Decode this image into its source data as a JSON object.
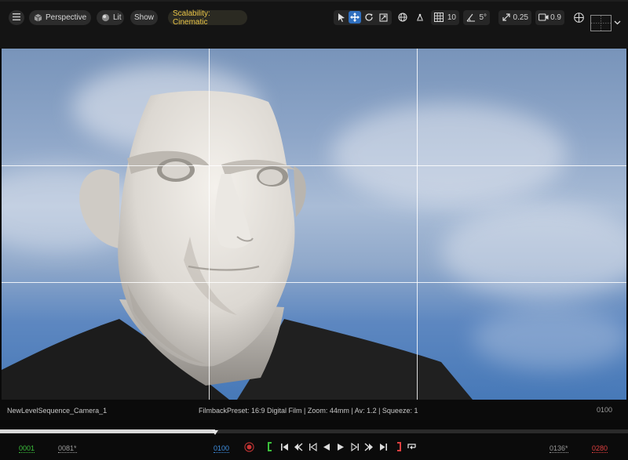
{
  "toolbar": {
    "perspective_label": "Perspective",
    "lit_label": "Lit",
    "show_label": "Show",
    "scalability_label": "Scalability: Cinematic",
    "grid_snap_value": "10",
    "rotation_snap_value": "5°",
    "scale_snap_value": "0.25",
    "camera_speed_value": "0.9",
    "icons": [
      "hamburger-menu-icon",
      "perspective-cube-icon",
      "lit-sphere-icon",
      "select-arrow-icon",
      "translate-icon",
      "rotate-icon",
      "scale-icon",
      "world-globe-icon",
      "surface-snap-icon",
      "grid-icon",
      "angle-icon",
      "scale-arrow-icon",
      "camera-icon",
      "layout-grid-icon",
      "viewport-layout-icon",
      "chevron-down-icon"
    ],
    "accent_color": "#2f6fbf",
    "scalability_color": "#e8c347"
  },
  "info": {
    "camera_name": "NewLevelSequence_Camera_1",
    "filmback": "FilmbackPreset: 16:9 Digital Film | Zoom: 44mm | Av: 1.2 | Squeeze: 1",
    "current_frame": "0100"
  },
  "timeline": {
    "playhead_progress": 0.343
  },
  "transport": {
    "start_frame": "0001",
    "range_start": "0081*",
    "current_frame": "0100",
    "range_end": "0136*",
    "end_frame": "0280",
    "icons": [
      "record-icon",
      "mark-in-icon",
      "jump-start-icon",
      "step-back-key-icon",
      "step-back-frame-icon",
      "play-reverse-icon",
      "play-icon",
      "step-forward-frame-icon",
      "step-forward-key-icon",
      "jump-end-icon",
      "mark-out-icon",
      "loop-icon"
    ],
    "start_color": "#3bbf3b",
    "end_color": "#e04040",
    "current_color": "#3f8fe0"
  }
}
